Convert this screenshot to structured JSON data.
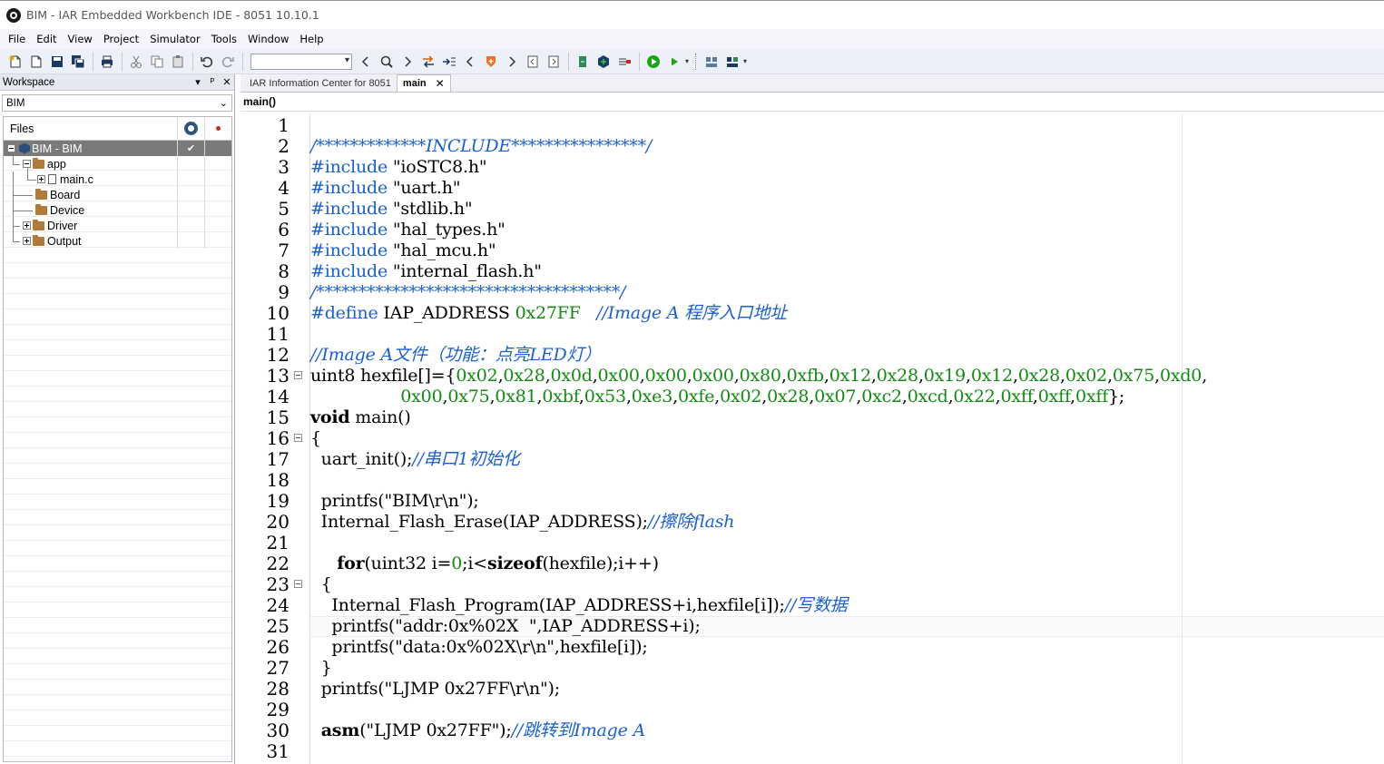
{
  "window": {
    "title": "BIM - IAR Embedded Workbench IDE - 8051 10.10.1"
  },
  "menu": [
    "File",
    "Edit",
    "View",
    "Project",
    "Simulator",
    "Tools",
    "Window",
    "Help"
  ],
  "workspace": {
    "title": "Workspace",
    "pin": "ᴾ",
    "close": "✕",
    "selected_config": "BIM",
    "files_header": "Files",
    "tree": [
      {
        "label": "BIM - BIM",
        "check": "✔"
      },
      {
        "label": "app"
      },
      {
        "label": "main.c"
      },
      {
        "label": "Board"
      },
      {
        "label": "Device"
      },
      {
        "label": "Driver"
      },
      {
        "label": "Output"
      }
    ]
  },
  "editor": {
    "tabs": [
      {
        "label": "IAR Information Center for 8051"
      },
      {
        "label": "main",
        "close": "✕"
      }
    ],
    "function_scope": "main()",
    "lines": [
      "",
      "/*************INCLUDE****************/",
      "#include \"ioSTC8.h\"",
      "#include \"uart.h\"",
      "#include \"stdlib.h\"",
      "#include \"hal_types.h\"",
      "#include \"hal_mcu.h\"",
      "#include \"internal_flash.h\"",
      "/************************************/",
      "#define IAP_ADDRESS 0x27FF   //Image A 程序入口地址",
      "",
      "//Image A文件（功能：点亮LED灯）",
      "uint8 hexfile[]={0x02,0x28,0x0d,0x00,0x00,0x00,0x80,0xfb,0x12,0x28,0x19,0x12,0x28,0x02,0x75,0xd0,",
      "                 0x00,0x75,0x81,0xbf,0x53,0xe3,0xfe,0x02,0x28,0x07,0xc2,0xcd,0x22,0xff,0xff,0xff};",
      "void main()",
      "{",
      "  uart_init();//串口1初始化",
      "",
      "  printfs(\"BIM\\r\\n\");",
      "  Internal_Flash_Erase(IAP_ADDRESS);//擦除flash",
      "",
      "     for(uint32 i=0;i<sizeof(hexfile);i++)",
      "  {",
      "    Internal_Flash_Program(IAP_ADDRESS+i,hexfile[i]);//写数据",
      "    printfs(\"addr:0x%02X  \",IAP_ADDRESS+i);",
      "    printfs(\"data:0x%02X\\r\\n\",hexfile[i]);",
      "  }",
      "  printfs(\"LJMP 0x27FF\\r\\n\");",
      "",
      "  asm(\"LJMP 0x27FF\");//跳转到Image A",
      ""
    ],
    "fold_lines": [
      13,
      16,
      23
    ],
    "current_line": 25,
    "colors": {
      "comment": "#1a5fd6",
      "number": "#108a10",
      "preprocessor": "#1a5fd6"
    }
  }
}
